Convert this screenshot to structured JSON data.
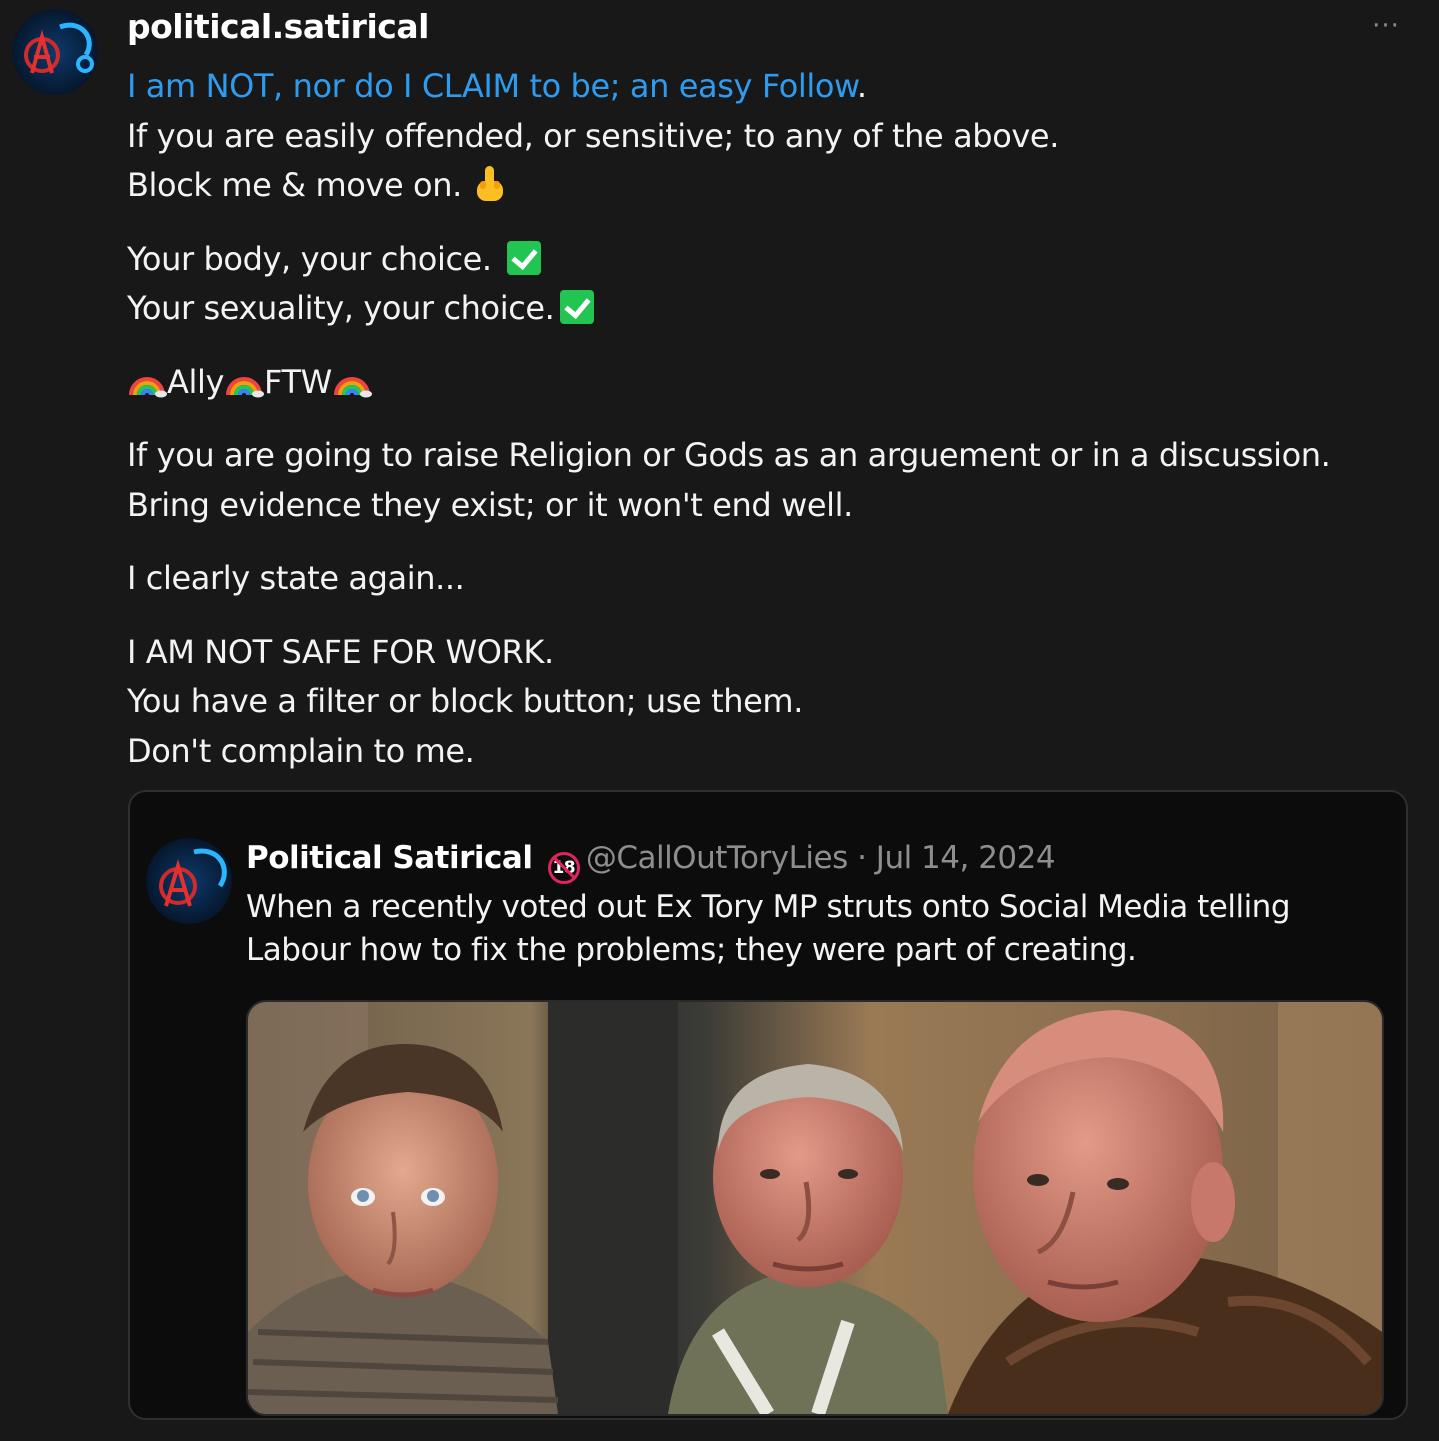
{
  "post": {
    "username": "political.satirical",
    "more_label": "···",
    "bio": {
      "link_text": "I am NOT, nor do I CLAIM to be; an easy Follow",
      "link_suffix": ".",
      "line2": "If you are easily offended, or sensitive; to any of the above.",
      "line3": "Block me & move on.",
      "line4": "Your body, your choice.",
      "line5": "Your sexuality, your choice.",
      "ally_word": "Ally",
      "ftw_word": "FTW",
      "line7": "If you are going to raise Religion or Gods as an arguement or in a discussion.",
      "line8": "Bring evidence they exist; or it won't end well.",
      "line9": "I clearly state again...",
      "line10": "I AM NOT SAFE FOR WORK.",
      "line11": "You have a filter or block button; use them.",
      "line12": "Don't complain to me."
    }
  },
  "embed": {
    "display_name": "Political Satirical",
    "age_badge": "18",
    "handle": "@CallOutToryLies",
    "separator": "·",
    "date": "Jul 14, 2024",
    "text": "When a recently voted out Ex Tory MP struts onto Social Media telling Labour how to fix the problems; they were part of creating."
  },
  "colors": {
    "background": "#181818",
    "link": "#2f9bef",
    "embed_background": "#0c0c0c",
    "muted": "#8e8e8e",
    "badge_red": "#e0245e",
    "check_green": "#23c552"
  },
  "icons": {
    "more": "more-horizontal-icon",
    "finger": "middle-finger-emoji",
    "check": "check-mark-emoji",
    "rainbow": "rainbow-emoji",
    "age": "no-under-18-icon"
  }
}
